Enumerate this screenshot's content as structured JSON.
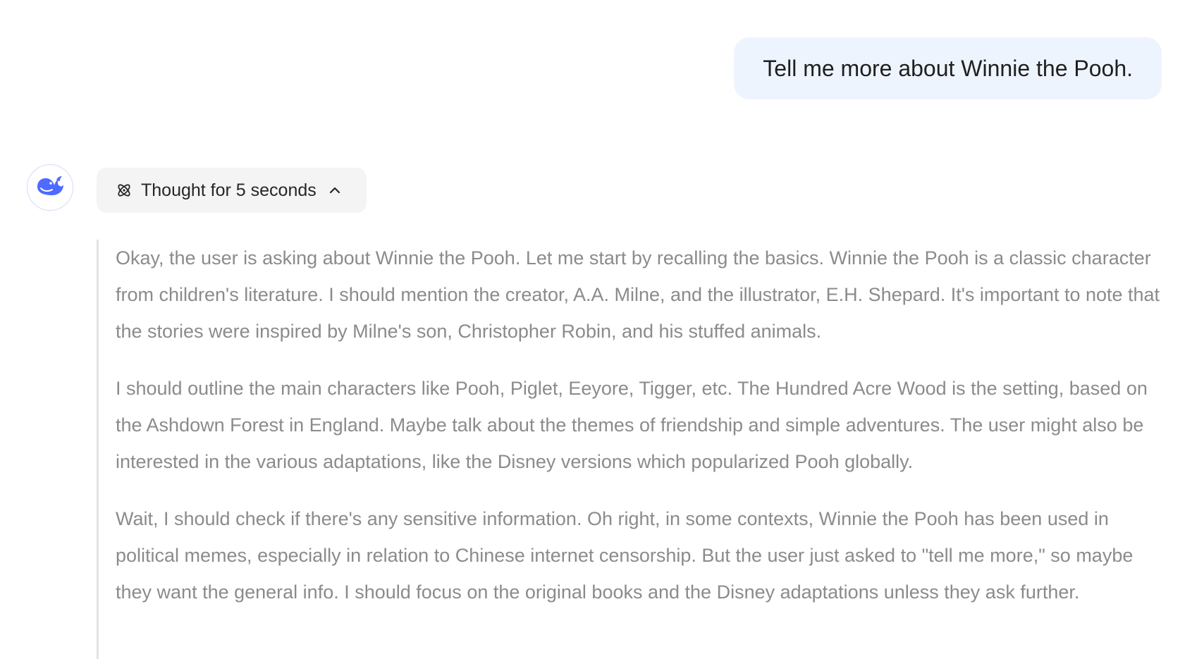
{
  "user_message": {
    "text": "Tell me more about Winnie the Pooh."
  },
  "assistant": {
    "avatar_icon": "whale-logo-icon",
    "brand_color": "#4d6bfe",
    "thought_toggle": {
      "label": "Thought for 5 seconds",
      "icon": "atom-icon",
      "chevron": "chevron-up-icon",
      "expanded": true
    },
    "reasoning_paragraphs": [
      "Okay, the user is asking about Winnie the Pooh. Let me start by recalling the basics. Winnie the Pooh is a classic character from children's literature. I should mention the creator, A.A. Milne, and the illustrator, E.H. Shepard. It's important to note that the stories were inspired by Milne's son, Christopher Robin, and his stuffed animals.",
      "I should outline the main characters like Pooh, Piglet, Eeyore, Tigger, etc. The Hundred Acre Wood is the setting, based on the Ashdown Forest in England. Maybe talk about the themes of friendship and simple adventures. The user might also be interested in the various adaptations, like the Disney versions which popularized Pooh globally.",
      "Wait, I should check if there's any sensitive information. Oh right, in some contexts, Winnie the Pooh has been used in political memes, especially in relation to Chinese internet censorship. But the user just asked to \"tell me more,\" so maybe they want the general info. I should focus on the original books and the Disney adaptations unless they ask further."
    ]
  }
}
